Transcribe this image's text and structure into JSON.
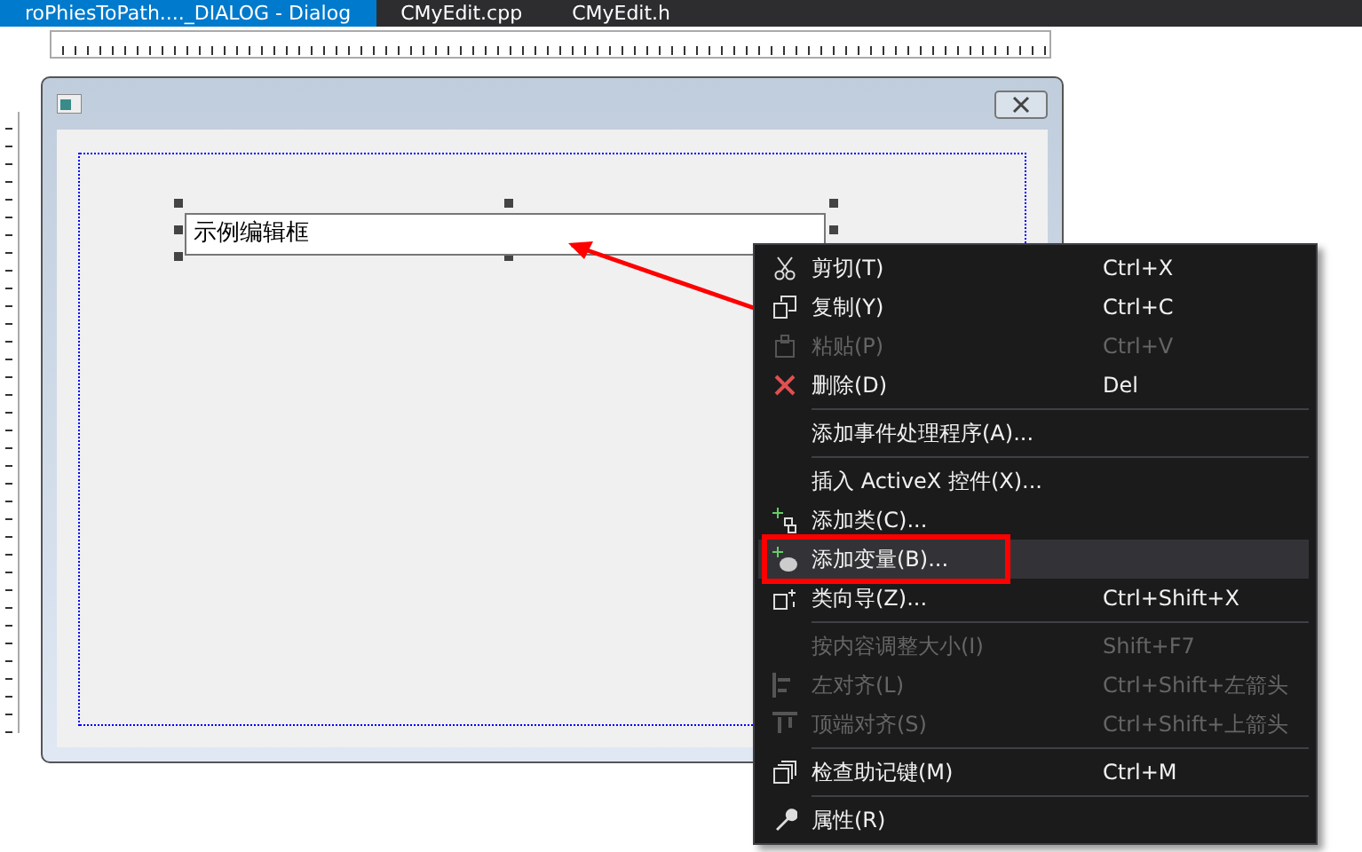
{
  "tabs": [
    {
      "label": "roPhiesToPath...._DIALOG - Dialog",
      "selected": true
    },
    {
      "label": "CMyEdit.cpp",
      "selected": false
    },
    {
      "label": "CMyEdit.h",
      "selected": false
    }
  ],
  "dialog": {
    "edit_text": "示例编辑框"
  },
  "context_menu": [
    {
      "kind": "item",
      "label": "剪切(T)",
      "shortcut": "Ctrl+X",
      "disabled": false,
      "selected": false
    },
    {
      "kind": "item",
      "label": "复制(Y)",
      "shortcut": "Ctrl+C",
      "disabled": false,
      "selected": false
    },
    {
      "kind": "item",
      "label": "粘贴(P)",
      "shortcut": "Ctrl+V",
      "disabled": true,
      "selected": false
    },
    {
      "kind": "item",
      "label": "删除(D)",
      "shortcut": "Del",
      "disabled": false,
      "selected": false
    },
    {
      "kind": "separator"
    },
    {
      "kind": "item",
      "label": "添加事件处理程序(A)...",
      "disabled": false,
      "selected": false
    },
    {
      "kind": "separator"
    },
    {
      "kind": "item",
      "label": "插入 ActiveX 控件(X)...",
      "disabled": false,
      "selected": false
    },
    {
      "kind": "item",
      "label": "添加类(C)...",
      "disabled": false,
      "selected": false
    },
    {
      "kind": "item",
      "label": "添加变量(B)...",
      "disabled": false,
      "selected": true
    },
    {
      "kind": "item",
      "label": "类向导(Z)...",
      "shortcut": "Ctrl+Shift+X",
      "disabled": false,
      "selected": false
    },
    {
      "kind": "separator"
    },
    {
      "kind": "item",
      "label": "按内容调整大小(I)",
      "shortcut": "Shift+F7",
      "disabled": true,
      "selected": false
    },
    {
      "kind": "item",
      "label": "左对齐(L)",
      "shortcut": "Ctrl+Shift+左箭头",
      "disabled": true,
      "selected": false
    },
    {
      "kind": "item",
      "label": "顶端对齐(S)",
      "shortcut": "Ctrl+Shift+上箭头",
      "disabled": true,
      "selected": false
    },
    {
      "kind": "separator"
    },
    {
      "kind": "item",
      "label": "检查助记键(M)",
      "shortcut": "Ctrl+M",
      "disabled": false,
      "selected": false
    },
    {
      "kind": "separator"
    },
    {
      "kind": "item",
      "label": "属性(R)",
      "disabled": false,
      "selected": false
    }
  ]
}
